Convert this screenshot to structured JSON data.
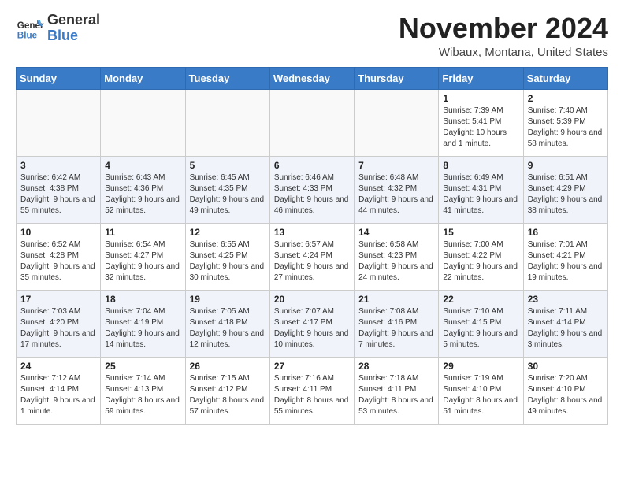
{
  "header": {
    "logo_line1": "General",
    "logo_line2": "Blue",
    "month": "November 2024",
    "location": "Wibaux, Montana, United States"
  },
  "weekdays": [
    "Sunday",
    "Monday",
    "Tuesday",
    "Wednesday",
    "Thursday",
    "Friday",
    "Saturday"
  ],
  "weeks": [
    [
      {
        "day": "",
        "info": ""
      },
      {
        "day": "",
        "info": ""
      },
      {
        "day": "",
        "info": ""
      },
      {
        "day": "",
        "info": ""
      },
      {
        "day": "",
        "info": ""
      },
      {
        "day": "1",
        "info": "Sunrise: 7:39 AM\nSunset: 5:41 PM\nDaylight: 10 hours and 1 minute."
      },
      {
        "day": "2",
        "info": "Sunrise: 7:40 AM\nSunset: 5:39 PM\nDaylight: 9 hours and 58 minutes."
      }
    ],
    [
      {
        "day": "3",
        "info": "Sunrise: 6:42 AM\nSunset: 4:38 PM\nDaylight: 9 hours and 55 minutes."
      },
      {
        "day": "4",
        "info": "Sunrise: 6:43 AM\nSunset: 4:36 PM\nDaylight: 9 hours and 52 minutes."
      },
      {
        "day": "5",
        "info": "Sunrise: 6:45 AM\nSunset: 4:35 PM\nDaylight: 9 hours and 49 minutes."
      },
      {
        "day": "6",
        "info": "Sunrise: 6:46 AM\nSunset: 4:33 PM\nDaylight: 9 hours and 46 minutes."
      },
      {
        "day": "7",
        "info": "Sunrise: 6:48 AM\nSunset: 4:32 PM\nDaylight: 9 hours and 44 minutes."
      },
      {
        "day": "8",
        "info": "Sunrise: 6:49 AM\nSunset: 4:31 PM\nDaylight: 9 hours and 41 minutes."
      },
      {
        "day": "9",
        "info": "Sunrise: 6:51 AM\nSunset: 4:29 PM\nDaylight: 9 hours and 38 minutes."
      }
    ],
    [
      {
        "day": "10",
        "info": "Sunrise: 6:52 AM\nSunset: 4:28 PM\nDaylight: 9 hours and 35 minutes."
      },
      {
        "day": "11",
        "info": "Sunrise: 6:54 AM\nSunset: 4:27 PM\nDaylight: 9 hours and 32 minutes."
      },
      {
        "day": "12",
        "info": "Sunrise: 6:55 AM\nSunset: 4:25 PM\nDaylight: 9 hours and 30 minutes."
      },
      {
        "day": "13",
        "info": "Sunrise: 6:57 AM\nSunset: 4:24 PM\nDaylight: 9 hours and 27 minutes."
      },
      {
        "day": "14",
        "info": "Sunrise: 6:58 AM\nSunset: 4:23 PM\nDaylight: 9 hours and 24 minutes."
      },
      {
        "day": "15",
        "info": "Sunrise: 7:00 AM\nSunset: 4:22 PM\nDaylight: 9 hours and 22 minutes."
      },
      {
        "day": "16",
        "info": "Sunrise: 7:01 AM\nSunset: 4:21 PM\nDaylight: 9 hours and 19 minutes."
      }
    ],
    [
      {
        "day": "17",
        "info": "Sunrise: 7:03 AM\nSunset: 4:20 PM\nDaylight: 9 hours and 17 minutes."
      },
      {
        "day": "18",
        "info": "Sunrise: 7:04 AM\nSunset: 4:19 PM\nDaylight: 9 hours and 14 minutes."
      },
      {
        "day": "19",
        "info": "Sunrise: 7:05 AM\nSunset: 4:18 PM\nDaylight: 9 hours and 12 minutes."
      },
      {
        "day": "20",
        "info": "Sunrise: 7:07 AM\nSunset: 4:17 PM\nDaylight: 9 hours and 10 minutes."
      },
      {
        "day": "21",
        "info": "Sunrise: 7:08 AM\nSunset: 4:16 PM\nDaylight: 9 hours and 7 minutes."
      },
      {
        "day": "22",
        "info": "Sunrise: 7:10 AM\nSunset: 4:15 PM\nDaylight: 9 hours and 5 minutes."
      },
      {
        "day": "23",
        "info": "Sunrise: 7:11 AM\nSunset: 4:14 PM\nDaylight: 9 hours and 3 minutes."
      }
    ],
    [
      {
        "day": "24",
        "info": "Sunrise: 7:12 AM\nSunset: 4:14 PM\nDaylight: 9 hours and 1 minute."
      },
      {
        "day": "25",
        "info": "Sunrise: 7:14 AM\nSunset: 4:13 PM\nDaylight: 8 hours and 59 minutes."
      },
      {
        "day": "26",
        "info": "Sunrise: 7:15 AM\nSunset: 4:12 PM\nDaylight: 8 hours and 57 minutes."
      },
      {
        "day": "27",
        "info": "Sunrise: 7:16 AM\nSunset: 4:11 PM\nDaylight: 8 hours and 55 minutes."
      },
      {
        "day": "28",
        "info": "Sunrise: 7:18 AM\nSunset: 4:11 PM\nDaylight: 8 hours and 53 minutes."
      },
      {
        "day": "29",
        "info": "Sunrise: 7:19 AM\nSunset: 4:10 PM\nDaylight: 8 hours and 51 minutes."
      },
      {
        "day": "30",
        "info": "Sunrise: 7:20 AM\nSunset: 4:10 PM\nDaylight: 8 hours and 49 minutes."
      }
    ]
  ]
}
